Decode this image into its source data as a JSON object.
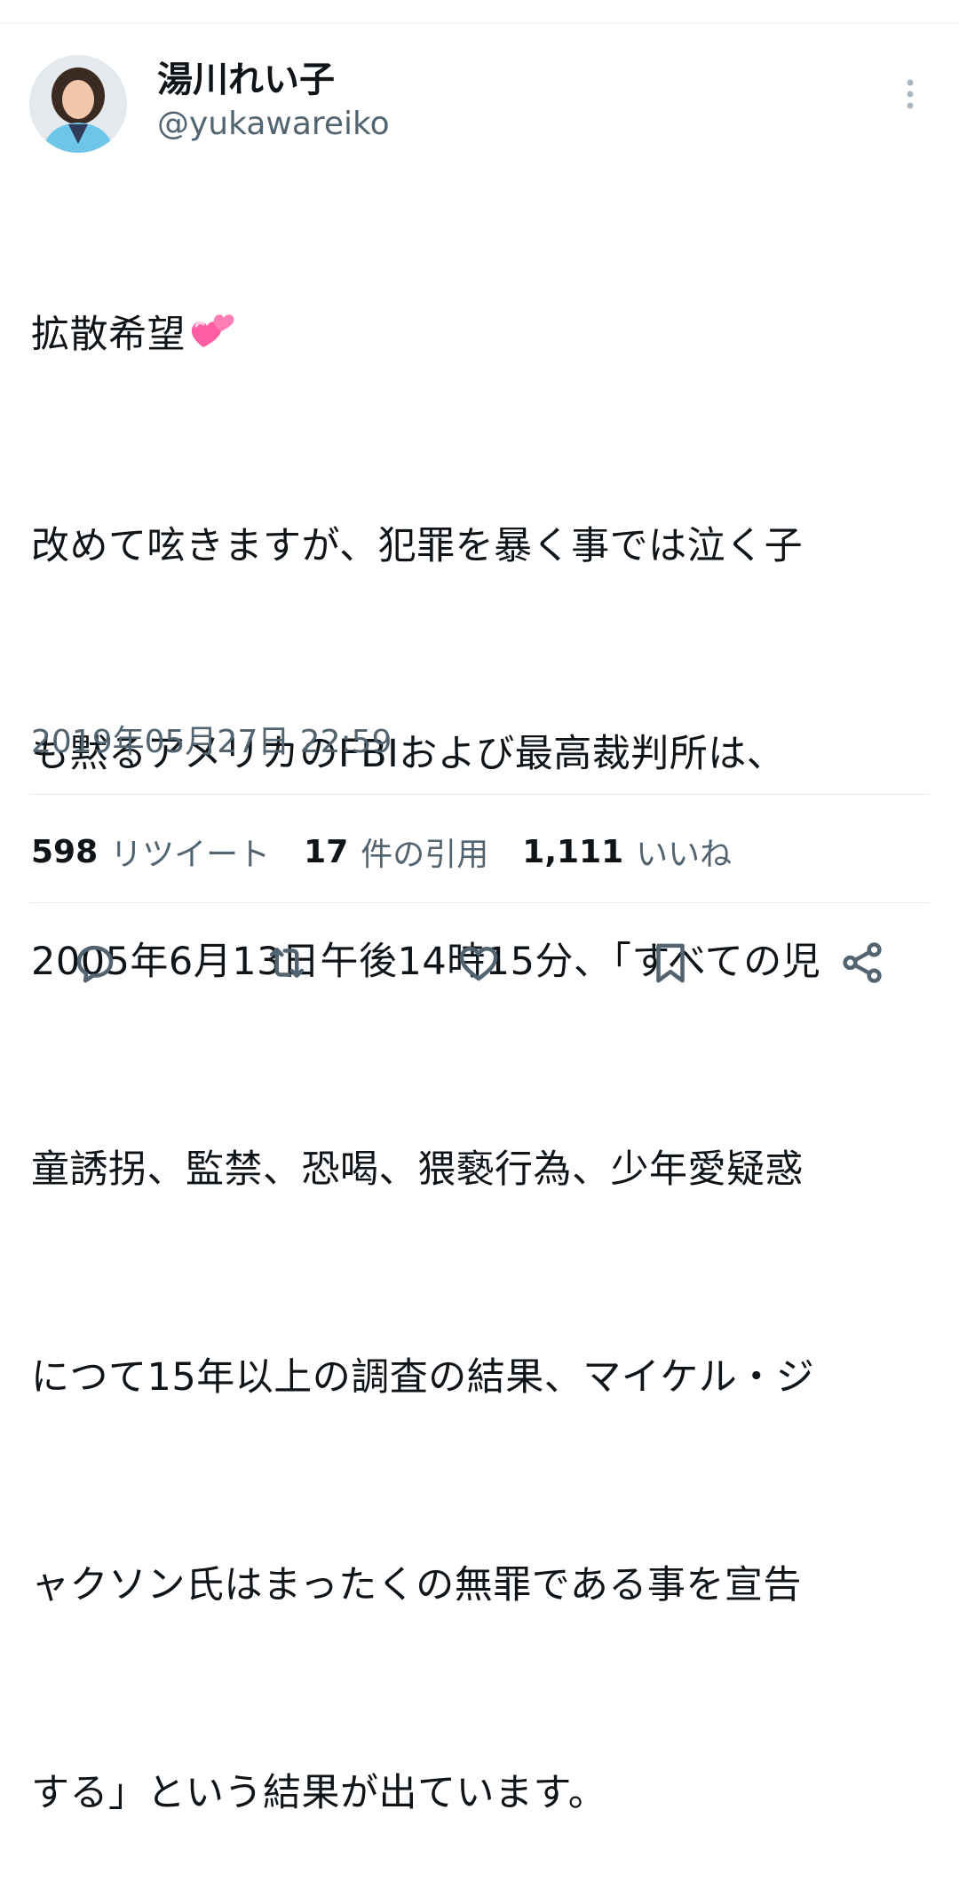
{
  "author": {
    "display_name": "湯川れい子",
    "handle": "@yukawareiko"
  },
  "tweet": {
    "lines": [
      "拡散希望",
      "改めて呟きますが、犯罪を暴く事では泣く子",
      "も黙るアメリカのFBIおよび最高裁判所は、",
      "2005年6月13日午後14時15分、「すべての児",
      "童誘拐、監禁、恐喝、猥褻行為、少年愛疑惑",
      "につて15年以上の調査の結果、マイケル・ジ",
      "ャクソン氏はまったくの無罪である事を宣告",
      "する」という結果が出ています。"
    ],
    "emoji_icon": "two-hearts-emoji",
    "timestamp": "2019年05月27日 22:59"
  },
  "stats": {
    "retweets_count": "598",
    "retweets_label": "リツイート",
    "quotes_count": "17",
    "quotes_label": "件の引用",
    "likes_count": "1,111",
    "likes_label": "いいね"
  },
  "actions": [
    "reply-icon",
    "retweet-icon",
    "like-icon",
    "bookmark-icon",
    "share-icon"
  ],
  "colors": {
    "text_primary": "#0f1419",
    "text_secondary": "#536471",
    "divider": "#e6ecf0",
    "avatar_jacket": "#6ec6e8",
    "emoji_pink": "#ff5fa2"
  }
}
